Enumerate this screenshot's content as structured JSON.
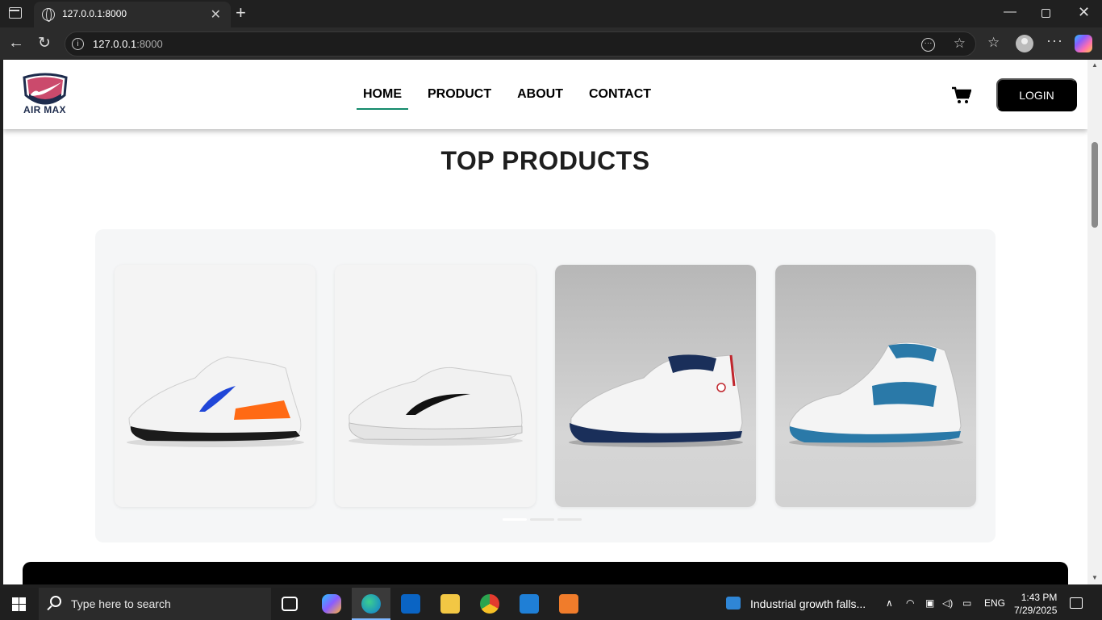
{
  "browser": {
    "tab_title": "127.0.0.1:8000",
    "url_host": "127.0.0.1",
    "url_port": ":8000"
  },
  "site": {
    "logo_text": "AIR MAX",
    "nav": [
      {
        "label": "HOME",
        "active": true
      },
      {
        "label": "PRODUCT",
        "active": false
      },
      {
        "label": "ABOUT",
        "active": false
      },
      {
        "label": "CONTACT",
        "active": false
      }
    ],
    "login_label": "LOGIN",
    "section_title": "TOP PRODUCTS",
    "colors": {
      "active_underline": "#138a6b",
      "login_bg": "#000000"
    },
    "products": [
      {
        "icon": "white-running-shoe-blue-swoosh-orange-heel"
      },
      {
        "icon": "white-running-shoe-black-swoosh"
      },
      {
        "icon": "white-navy-basketball-shoe"
      },
      {
        "icon": "white-blue-high-top-jordan-shoe"
      }
    ]
  },
  "taskbar": {
    "search_placeholder": "Type here to search",
    "news_text": "Industrial growth falls...",
    "language": "ENG",
    "time": "1:43 PM",
    "date": "7/29/2025"
  }
}
